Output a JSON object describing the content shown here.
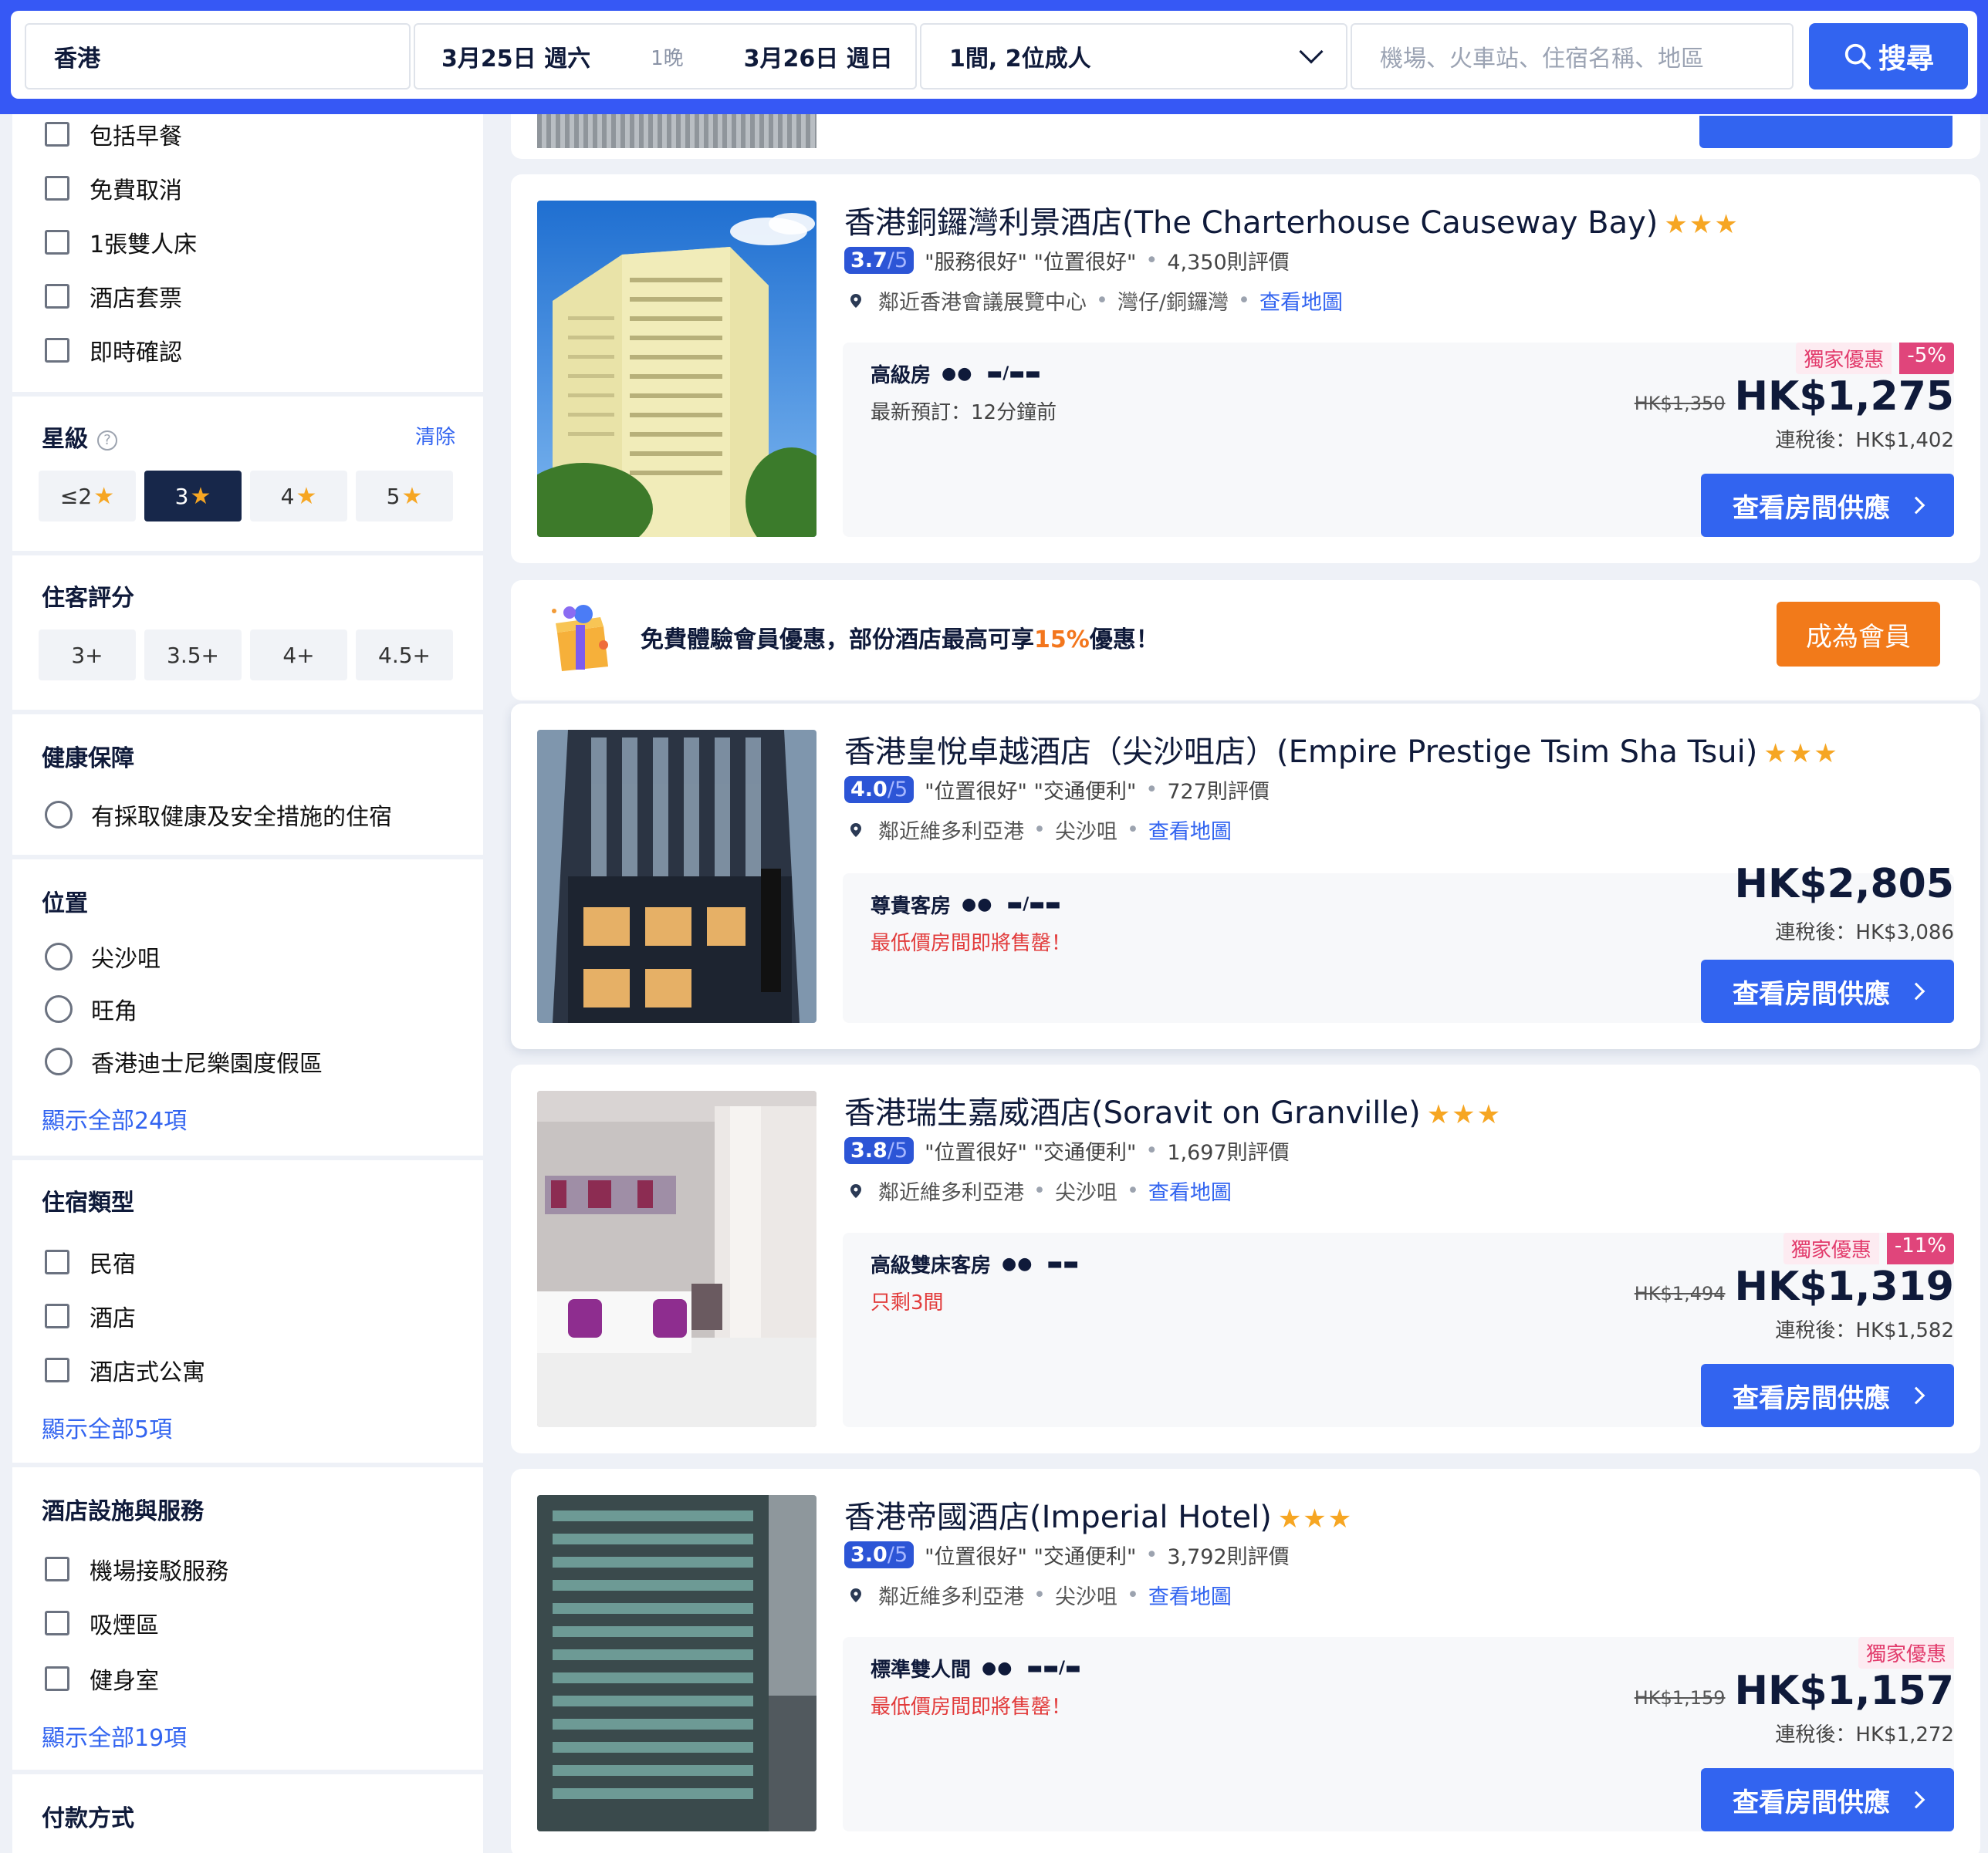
{
  "search": {
    "destination": "香港",
    "checkin": "3月25日 週六",
    "nights": "1晚",
    "checkout": "3月26日 週日",
    "guests": "1間, 2位成人",
    "keyword_placeholder": "機場、火車站、住宿名稱、地區",
    "search_label": "搜尋"
  },
  "sidebar": {
    "top_options": [
      "包括早餐",
      "免費取消",
      "1張雙人床",
      "酒店套票",
      "即時確認"
    ],
    "star": {
      "title": "星級",
      "clear": "清除",
      "chips": [
        "≤2",
        "3",
        "4",
        "5"
      ],
      "selected": "3"
    },
    "guest_rating": {
      "title": "住客評分",
      "chips": [
        "3+",
        "3.5+",
        "4+",
        "4.5+"
      ]
    },
    "health": {
      "title": "健康保障",
      "option": "有採取健康及安全措施的住宿"
    },
    "location": {
      "title": "位置",
      "options": [
        "尖沙咀",
        "旺角",
        "香港迪士尼樂園度假區"
      ],
      "show_all": "顯示全部24項"
    },
    "property_type": {
      "title": "住宿類型",
      "options": [
        "民宿",
        "酒店",
        "酒店式公寓"
      ],
      "show_all": "顯示全部5項"
    },
    "facilities": {
      "title": "酒店設施與服務",
      "options": [
        "機場接駁服務",
        "吸煙區",
        "健身室"
      ],
      "show_all": "顯示全部19項"
    },
    "payment": {
      "title": "付款方式"
    }
  },
  "promo": {
    "text_before": "免費體驗會員優惠，部份酒店最高可享",
    "highlight": "15%",
    "text_after": "優惠！",
    "button": "成為會員"
  },
  "common": {
    "view_rooms": "查看房間供應",
    "map_link": "查看地圖",
    "exclusive": "獨家優惠",
    "score_den": "/5"
  },
  "hotels": [
    {
      "name": "香港銅鑼灣利景酒店(The Charterhouse Causeway Bay)",
      "stars": "★★★",
      "score": "3.7",
      "tags": "\"服務很好\" \"位置很好\"",
      "reviews": "4,350則評價",
      "near": "鄰近香港會議展覽中心",
      "area": "灣仔/銅鑼灣",
      "room": "高級房",
      "beds": "▬/▬▬",
      "note": "最新預訂：12分鐘前",
      "discount": "-5%",
      "old_price": "HK$1,350",
      "price": "HK$1,275",
      "tax": "連稅後：HK$1,402"
    },
    {
      "name": "香港皇悅卓越酒店（尖沙咀店）(Empire Prestige Tsim Sha Tsui)",
      "stars": "★★★",
      "score": "4.0",
      "tags": "\"位置很好\" \"交通便利\"",
      "reviews": "727則評價",
      "near": "鄰近維多利亞港",
      "area": "尖沙咀",
      "room": "尊貴客房",
      "beds": "▬/▬▬",
      "note": "最低價房間即將售罄！",
      "price": "HK$2,805",
      "tax": "連稅後：HK$3,086"
    },
    {
      "name": "香港瑞生嘉威酒店(Soravit on Granville)",
      "stars": "★★★",
      "score": "3.8",
      "tags": "\"位置很好\" \"交通便利\"",
      "reviews": "1,697則評價",
      "near": "鄰近維多利亞港",
      "area": "尖沙咀",
      "room": "高級雙床客房",
      "beds": "▬▬",
      "note": "只剩3間",
      "discount": "-11%",
      "old_price": "HK$1,494",
      "price": "HK$1,319",
      "tax": "連稅後：HK$1,582"
    },
    {
      "name": "香港帝國酒店(Imperial Hotel)",
      "stars": "★★★",
      "score": "3.0",
      "tags": "\"位置很好\" \"交通便利\"",
      "reviews": "3,792則評價",
      "near": "鄰近維多利亞港",
      "area": "尖沙咀",
      "room": "標準雙人間",
      "beds": "▬▬/▬",
      "note": "最低價房間即將售罄！",
      "old_price": "HK$1,159",
      "price": "HK$1,157",
      "tax": "連稅後：HK$1,272"
    }
  ],
  "colors": {
    "brand": "#3658f5",
    "button": "#3264f0",
    "accent_orange": "#f27a1a",
    "star": "#f6a623"
  }
}
